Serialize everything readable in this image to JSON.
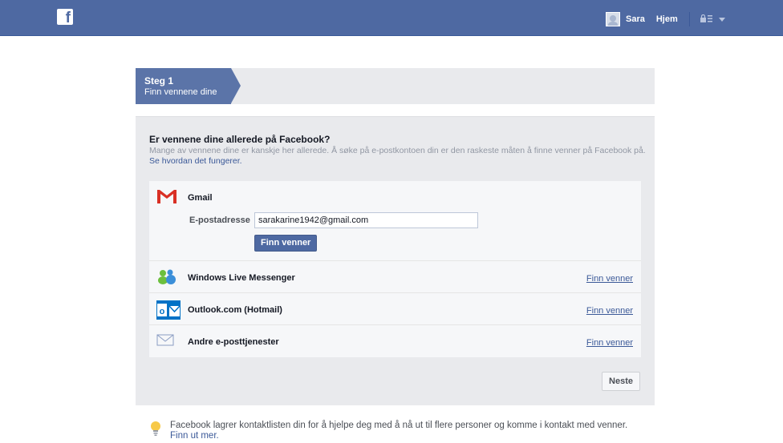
{
  "header": {
    "logo": "f",
    "user_name": "Sara",
    "home_label": "Hjem",
    "privacy_icon": "lock-icon",
    "account_menu_icon": "caret-down-icon"
  },
  "steps": {
    "step_title": "Steg 1",
    "step_subtitle": "Finn vennene dine"
  },
  "intro": {
    "heading": "Er vennene dine allerede på Facebook?",
    "description": "Mange av vennene dine er kanskje her allerede. Å søke på e-postkontoen din er den raskeste måten å finne venner på Facebook på.",
    "link": "Se hvordan det fungerer."
  },
  "providers": {
    "gmail": {
      "name": "Gmail",
      "email_label": "E-postadresse",
      "email_value": "sarakarine1942@gmail.com",
      "button": "Finn venner"
    },
    "items": [
      {
        "name": "Windows Live Messenger",
        "link": "Finn venner",
        "icon": "messenger-icon"
      },
      {
        "name": "Outlook.com (Hotmail)",
        "link": "Finn venner",
        "icon": "outlook-icon"
      },
      {
        "name": "Andre e-posttjenester",
        "link": "Finn venner",
        "icon": "envelope-icon"
      }
    ]
  },
  "next_button": "Neste",
  "footer": {
    "text": "Facebook lagrer kontaktlisten din for å hjelpe deg med å nå ut til flere personer og komme i kontakt med venner.",
    "link": "Finn ut mer."
  },
  "colors": {
    "brand": "#4e69a2",
    "link": "#3b5998"
  }
}
